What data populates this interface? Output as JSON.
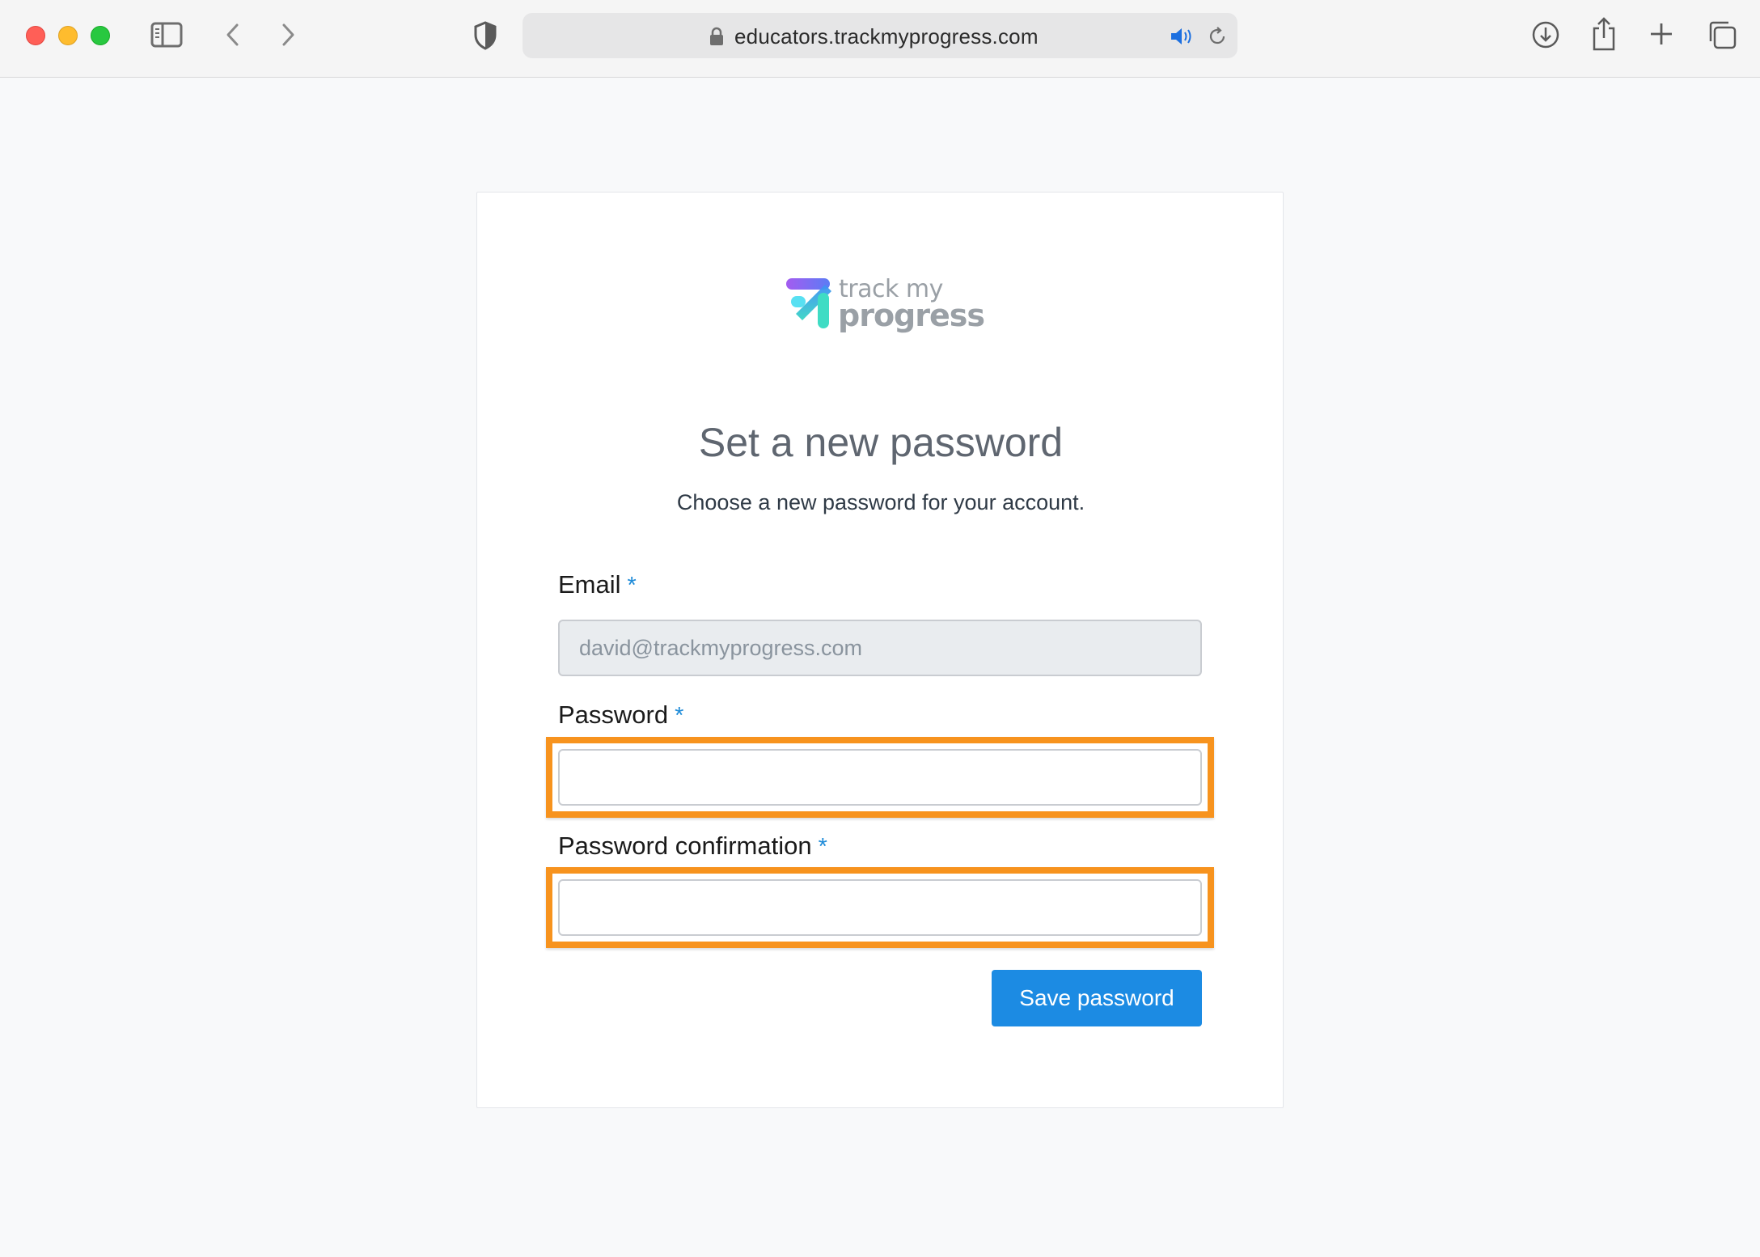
{
  "browser": {
    "url": "educators.trackmyprogress.com",
    "icons": {
      "sidebar": "sidebar-icon",
      "back": "chevron-left-icon",
      "forward": "chevron-right-icon",
      "shield": "shield-icon",
      "lock": "lock-icon",
      "audio": "speaker-icon",
      "reload": "reload-icon",
      "download": "download-icon",
      "share": "share-icon",
      "new_tab": "plus-icon",
      "tabs": "tabs-overview-icon"
    }
  },
  "logo": {
    "line1": "track my",
    "line2": "progress"
  },
  "page": {
    "title": "Set a new password",
    "subtitle": "Choose a new password for your account.",
    "required_marker": "*"
  },
  "form": {
    "email_label": "Email",
    "email_value": "david@trackmyprogress.com",
    "password_label": "Password",
    "password_value": "",
    "confirmation_label": "Password confirmation",
    "confirmation_value": "",
    "submit_label": "Save password"
  },
  "colors": {
    "accent": "#1c8be3",
    "highlight": "#f7931e",
    "required": "#1e8bd8"
  }
}
